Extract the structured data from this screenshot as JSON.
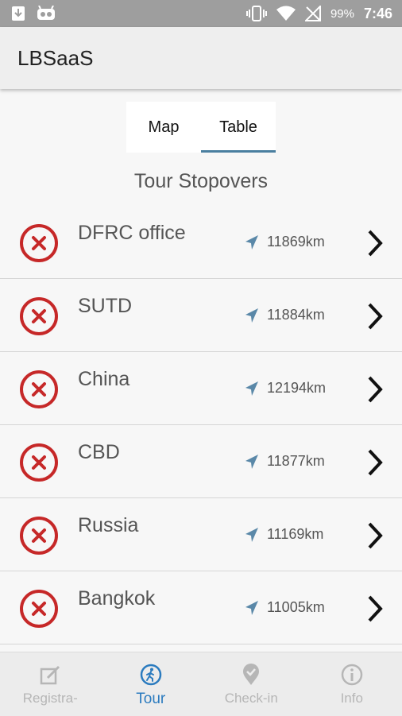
{
  "status_bar": {
    "battery": "99%",
    "time": "7:46"
  },
  "app": {
    "title": "LBSaaS"
  },
  "tabs": [
    {
      "label": "Map",
      "active": false
    },
    {
      "label": "Table",
      "active": true
    }
  ],
  "section_title": "Tour Stopovers",
  "stopovers": [
    {
      "name": "DFRC office",
      "distance": "11869km"
    },
    {
      "name": "SUTD",
      "distance": "11884km"
    },
    {
      "name": "China",
      "distance": "12194km"
    },
    {
      "name": "CBD",
      "distance": "11877km"
    },
    {
      "name": "Russia",
      "distance": "11169km"
    },
    {
      "name": "Bangkok",
      "distance": "11005km"
    }
  ],
  "bottom_nav": [
    {
      "label": "Registra-",
      "icon": "edit-icon",
      "active": false
    },
    {
      "label": "Tour",
      "icon": "walking-person-icon",
      "active": true
    },
    {
      "label": "Check-in",
      "icon": "map-pin-check-icon",
      "active": false
    },
    {
      "label": "Info",
      "icon": "info-icon",
      "active": false
    }
  ],
  "colors": {
    "accent": "#4a7fa0",
    "delete_red": "#c62828",
    "nav_active": "#2b7bbf",
    "nav_inactive": "#b6b6b6",
    "nav_arrow": "#5a88a8"
  }
}
